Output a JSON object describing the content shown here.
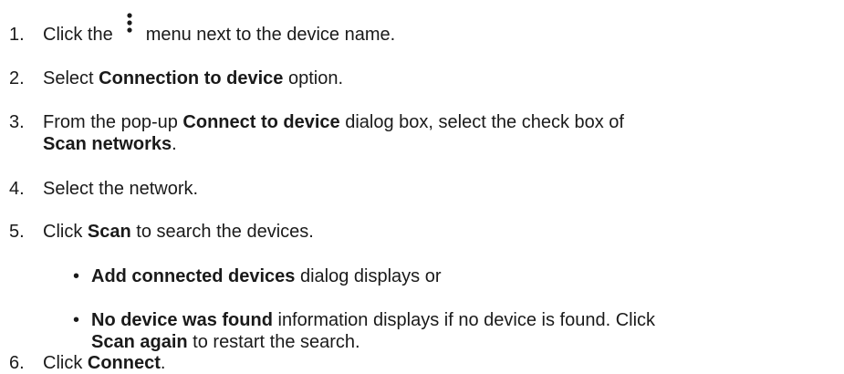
{
  "steps": [
    {
      "number": "1.",
      "pre": "Click the",
      "icon": "more-vertical-icon",
      "post": "menu next to the device name."
    },
    {
      "number": "2.",
      "pre": "Select ",
      "bold": "Connection to device",
      "post": " option."
    },
    {
      "number": "3.",
      "pre": "From the pop-up ",
      "bold": "Connect to device",
      "mid": " dialog box, select the check box of",
      "bold2": "Scan networks",
      "post": "."
    },
    {
      "number": "4.",
      "text": "Select the network."
    },
    {
      "number": "5.",
      "pre": "Click ",
      "bold": "Scan",
      "post": " to search the devices.",
      "subitems": [
        {
          "bullet": "•",
          "bold": "Add connected devices",
          "post": " dialog displays or"
        },
        {
          "bullet": "•",
          "bold": "No device was found",
          "mid": " information displays if no device is found. Click",
          "bold2": "Scan again",
          "post": " to restart the search."
        }
      ]
    },
    {
      "number": "6.",
      "pre": "Click ",
      "bold": "Connect",
      "post": "."
    }
  ]
}
